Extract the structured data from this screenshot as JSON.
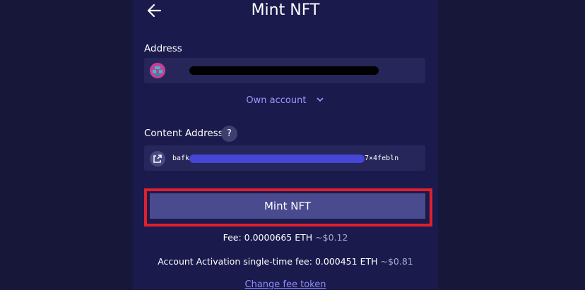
{
  "header": {
    "title": "Mint NFT",
    "back_icon": "arrow-left-icon"
  },
  "address": {
    "label": "Address",
    "avatar_icon": "avatar-icon",
    "value_redacted": true,
    "account_selector": "Own account",
    "account_selector_icon": "chevron-down-icon"
  },
  "content_address": {
    "label": "Content Address",
    "help_icon_label": "?",
    "external_icon": "external-link-icon",
    "value_prefix": "bafk",
    "value_suffix": "7×4febln"
  },
  "actions": {
    "mint_label": "Mint NFT",
    "highlight_color": "#e0202e"
  },
  "fees": {
    "fee_label": "Fee:",
    "fee_amount": "0.0000665",
    "fee_unit": "ETH",
    "fee_usd": "~$0.12",
    "activation_label": "Account Activation single-time fee:",
    "activation_amount": "0.000451",
    "activation_unit": "ETH",
    "activation_usd": "~$0.81",
    "change_fee_label": "Change fee token"
  }
}
